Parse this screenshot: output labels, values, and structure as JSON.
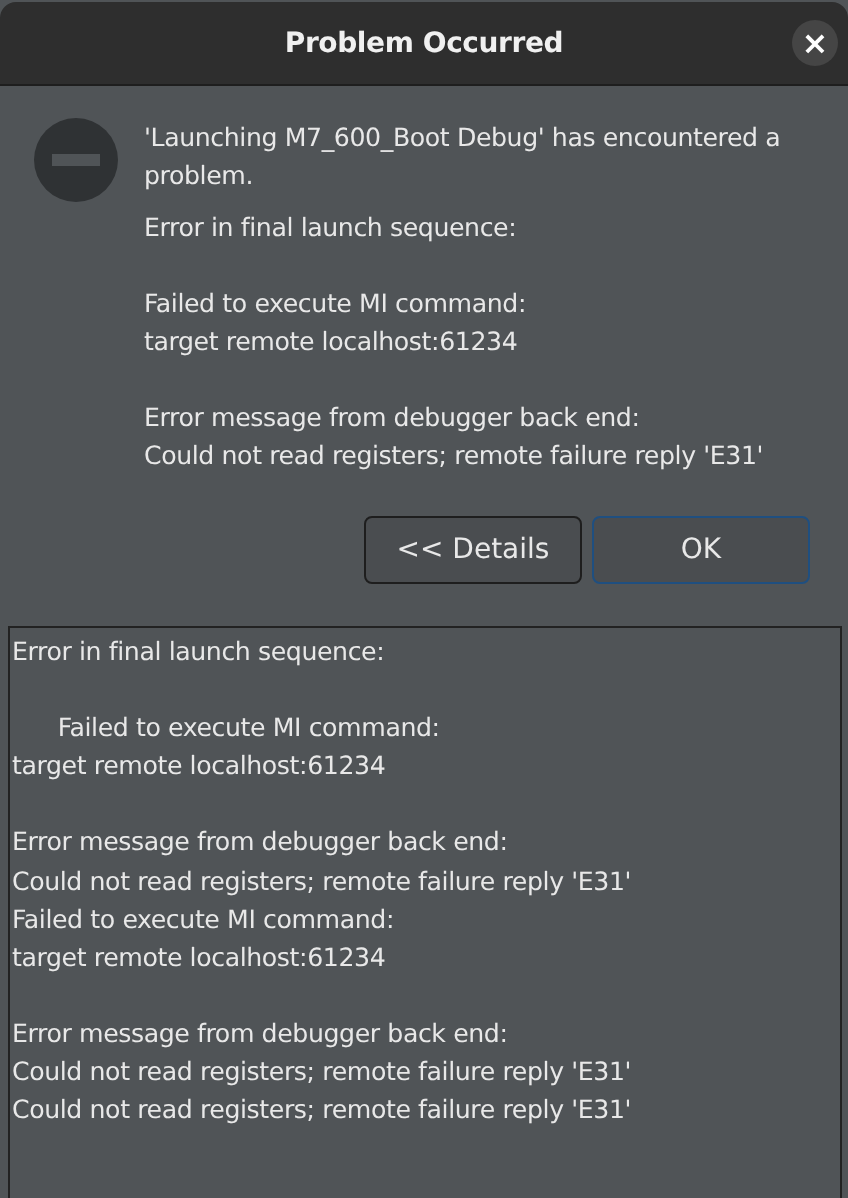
{
  "window": {
    "title": "Problem Occurred",
    "close": "×"
  },
  "message": {
    "heading": "'Launching M7_600_Boot Debug' has encountered a problem.",
    "paragraphs": [
      "Error in final launch sequence:",
      "Failed to execute MI command:\ntarget remote localhost:61234",
      "Error message from debugger back end:\nCould not read registers; remote failure reply 'E31'"
    ]
  },
  "buttons": [
    {
      "label": "<< Details",
      "selected": false
    },
    {
      "label": "OK",
      "selected": true
    }
  ],
  "details": {
    "text": "Error in final launch sequence:\n\n      Failed to execute MI command:\ntarget remote localhost:61234\n\nError message from debugger back end:\nCould not read registers; remote failure reply 'E31'\nFailed to execute MI command:\ntarget remote localhost:61234\n\nError message from debugger back end:\nCould not read registers; remote failure reply 'E31'\nCould not read registers; remote failure reply 'E31'"
  }
}
